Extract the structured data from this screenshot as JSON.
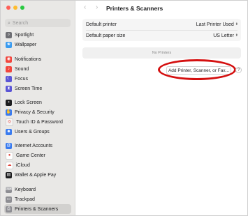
{
  "window": {
    "title": "Printers & Scanners"
  },
  "colors": {
    "close": "#ff5f57",
    "minimize": "#febc2e",
    "zoom": "#28c840",
    "annotation": "#d40f0f"
  },
  "search": {
    "placeholder": "Search"
  },
  "sidebar": {
    "groups": [
      {
        "items": [
          {
            "label": "Spotlight",
            "icon": "magnifier-icon",
            "color": "#6e6e73",
            "glyph": "⌕"
          },
          {
            "label": "Wallpaper",
            "icon": "wallpaper-icon",
            "color": "#3a9bf0",
            "glyph": "❀"
          }
        ]
      },
      {
        "items": [
          {
            "label": "Notifications",
            "icon": "bell-icon",
            "color": "#f2453d",
            "glyph": "◉"
          },
          {
            "label": "Sound",
            "icon": "speaker-icon",
            "color": "#f2453d",
            "glyph": "♪"
          },
          {
            "label": "Focus",
            "icon": "moon-icon",
            "color": "#5b55d6",
            "glyph": "☾"
          },
          {
            "label": "Screen Time",
            "icon": "hourglass-icon",
            "color": "#5b55d6",
            "glyph": "⧗"
          }
        ]
      },
      {
        "items": [
          {
            "label": "Lock Screen",
            "icon": "lock-icon",
            "color": "#1d1d1f",
            "glyph": "▪"
          },
          {
            "label": "Privacy & Security",
            "icon": "hand-icon",
            "color": "#3a7bef",
            "glyph": "✋"
          },
          {
            "label": "Touch ID & Password",
            "icon": "fingerprint-icon",
            "color": "#f5f5f5",
            "glyph": "◎"
          },
          {
            "label": "Users & Groups",
            "icon": "users-icon",
            "color": "#3a7bef",
            "glyph": "☻"
          }
        ]
      },
      {
        "items": [
          {
            "label": "Internet Accounts",
            "icon": "at-sign-icon",
            "color": "#3a7bef",
            "glyph": "@"
          },
          {
            "label": "Game Center",
            "icon": "game-center-icon",
            "color": "#ffffff",
            "glyph": "●"
          },
          {
            "label": "iCloud",
            "icon": "cloud-icon",
            "color": "#ffffff",
            "glyph": "☁"
          },
          {
            "label": "Wallet & Apple Pay",
            "icon": "wallet-icon",
            "color": "#1d1d1f",
            "glyph": "▤"
          }
        ]
      },
      {
        "items": [
          {
            "label": "Keyboard",
            "icon": "keyboard-icon",
            "color": "#8e8e93",
            "glyph": "⌨"
          },
          {
            "label": "Trackpad",
            "icon": "trackpad-icon",
            "color": "#8e8e93",
            "glyph": "▭"
          },
          {
            "label": "Printers & Scanners",
            "icon": "printer-icon",
            "color": "#8e8e93",
            "glyph": "⎙",
            "selected": true
          }
        ]
      }
    ]
  },
  "settings": {
    "default_printer": {
      "label": "Default printer",
      "value": "Last Printer Used"
    },
    "default_paper": {
      "label": "Default paper size",
      "value": "US Letter"
    }
  },
  "printers_list": {
    "empty_text": "No Printers"
  },
  "add_button": {
    "label": "Add Printer, Scanner, or Fax..."
  },
  "help": {
    "label": "?"
  },
  "nav": {
    "back": "‹",
    "forward": "›"
  }
}
